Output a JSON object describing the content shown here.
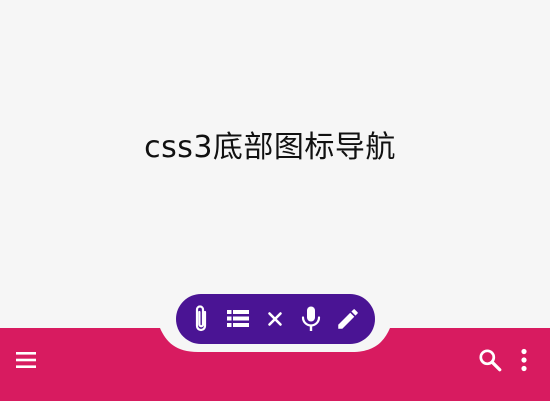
{
  "page": {
    "title": "css3底部图标导航"
  },
  "colors": {
    "background": "#f6f6f6",
    "bottom_bar": "#d81b60",
    "fab_pill": "#4a1494",
    "icon": "#ffffff"
  },
  "bottom_bar": {
    "left_icon": "menu-icon",
    "right_icons": [
      "search-icon",
      "more-vert-icon"
    ]
  },
  "fab_menu": {
    "items": [
      {
        "icon": "paperclip-icon"
      },
      {
        "icon": "list-icon"
      },
      {
        "icon": "close-icon"
      },
      {
        "icon": "microphone-icon"
      },
      {
        "icon": "pencil-icon"
      }
    ]
  }
}
